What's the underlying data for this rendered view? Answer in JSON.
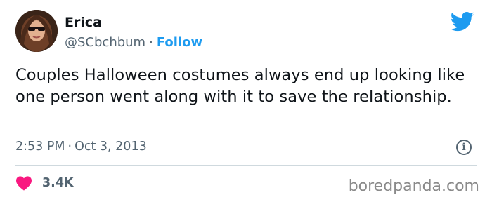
{
  "author": {
    "name": "Erica",
    "handle": "@SCbchbum",
    "separator": "·",
    "follow_label": "Follow"
  },
  "tweet": {
    "text": "Couples Halloween costumes always end up looking like one person went along with it to save the relationship.",
    "time": "2:53 PM",
    "separator": "·",
    "date": "Oct 3, 2013"
  },
  "engagement": {
    "likes": "3.4K"
  },
  "watermark": "boredpanda.com",
  "colors": {
    "accent": "#1d9bf0",
    "heart": "#f91880",
    "muted": "#536471",
    "text": "#0f1419"
  },
  "icons": {
    "brand": "twitter-bird-icon",
    "info": "info-icon",
    "like": "heart-icon"
  }
}
